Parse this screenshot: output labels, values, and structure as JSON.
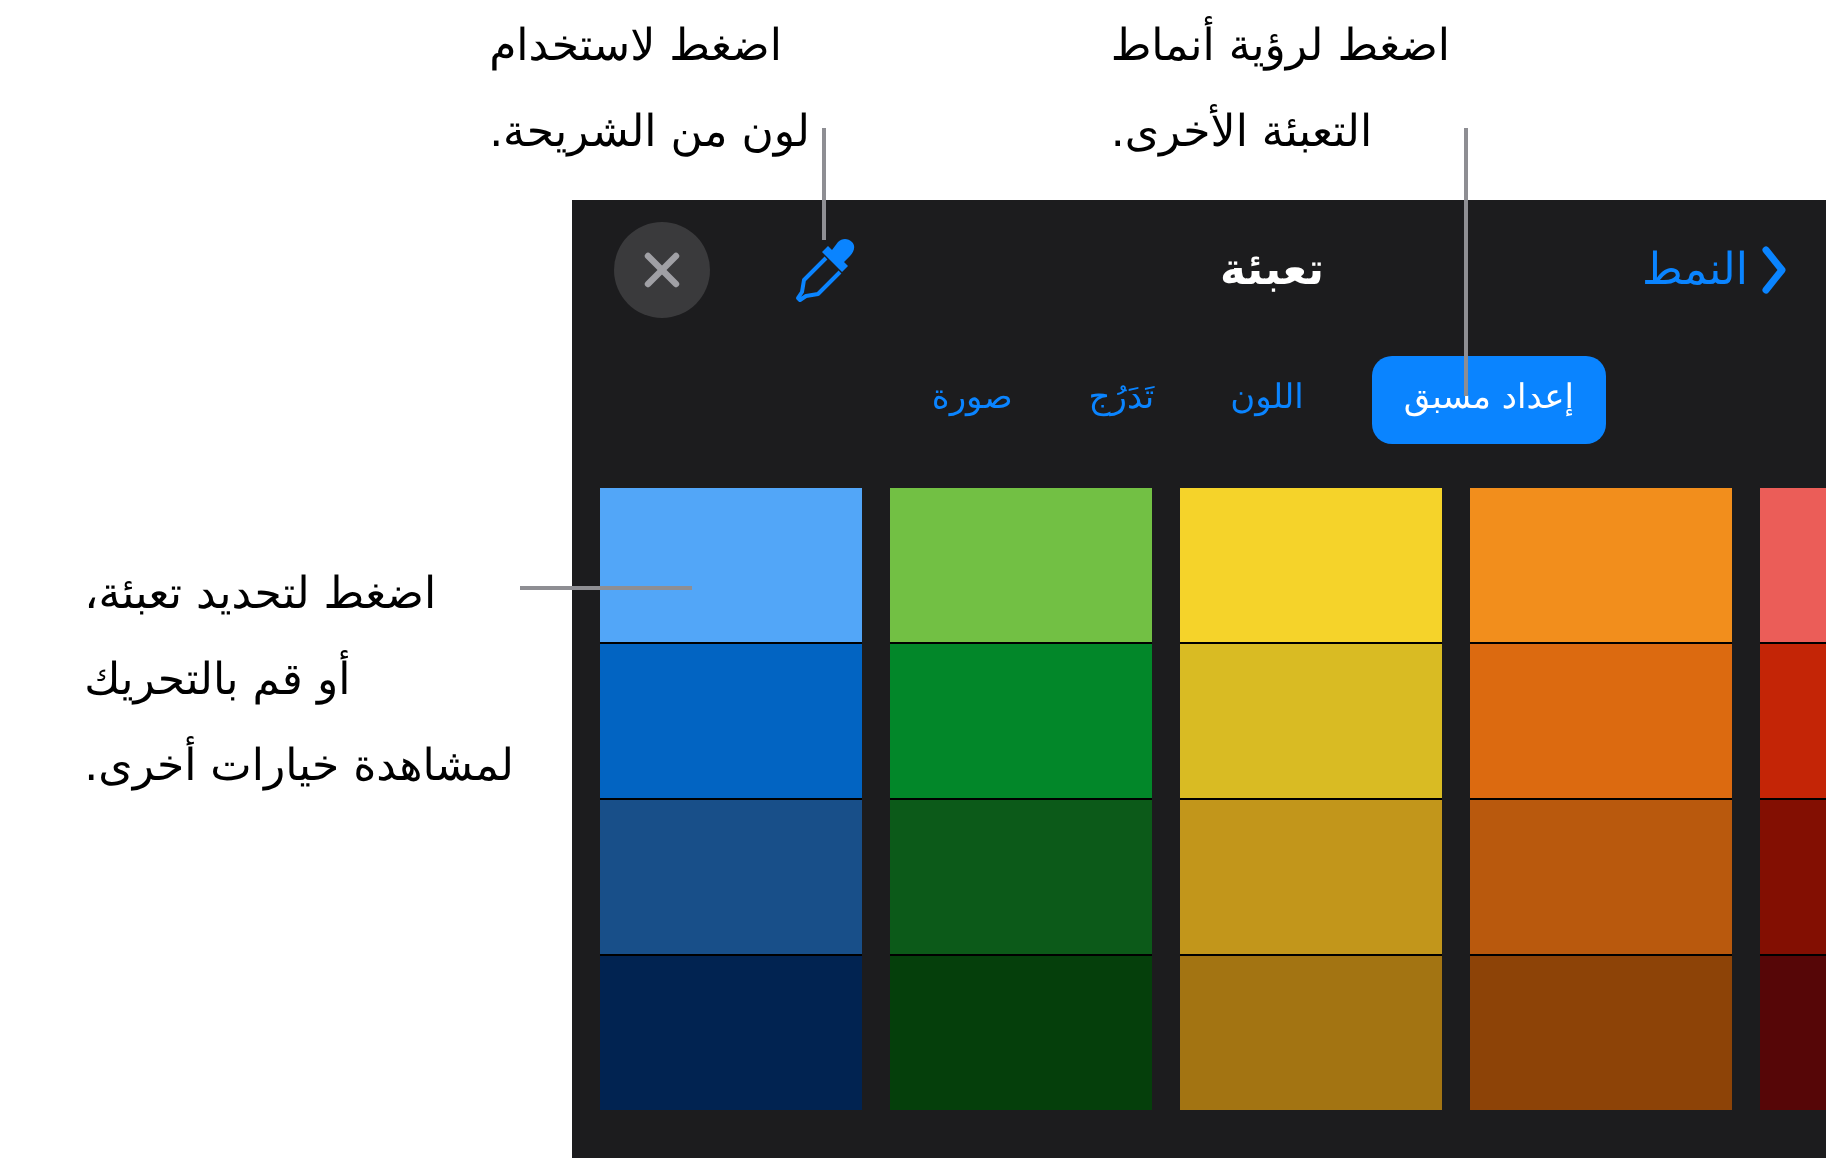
{
  "callouts": [
    {
      "kind": "tabs",
      "lines": [
        "اضغط لرؤية أنماط",
        "التعبئة الأخرى."
      ]
    },
    {
      "kind": "eyedropper",
      "lines": [
        "اضغط لاستخدام",
        "لون من الشريحة."
      ]
    },
    {
      "kind": "swatch",
      "lines": [
        "اضغط لتحديد تعبئة،",
        "أو قم بالتحريك",
        "لمشاهدة خيارات أخرى."
      ]
    }
  ],
  "header": {
    "back": "النمط",
    "title": "تعبئة"
  },
  "tabs": [
    {
      "label": "إعداد مسبق",
      "selected": true
    },
    {
      "label": "اللون",
      "selected": false
    },
    {
      "label": "تَدَرُج",
      "selected": false
    },
    {
      "label": "صورة",
      "selected": false
    }
  ],
  "palette": [
    {
      "swatches": [
        {
          "color": "#52a6f8"
        },
        {
          "color": "#0264c2"
        },
        {
          "color": "#184f89"
        },
        {
          "color": "#012351"
        }
      ]
    },
    {
      "swatches": [
        {
          "color": "#72c044"
        },
        {
          "color": "#028729"
        },
        {
          "color": "#0c5a19"
        },
        {
          "color": "#053f0b"
        }
      ]
    },
    {
      "swatches": [
        {
          "color": "#f5d32a"
        },
        {
          "color": "#d9bb23"
        },
        {
          "color": "#c2961b"
        },
        {
          "color": "#a37412"
        }
      ]
    },
    {
      "swatches": [
        {
          "color": "#f28e1c"
        },
        {
          "color": "#dc6a10"
        },
        {
          "color": "#b9590d"
        },
        {
          "color": "#8d4307"
        }
      ]
    },
    {
      "swatches": [
        {
          "color": "#eb5d58"
        },
        {
          "color": "#c42506"
        },
        {
          "color": "#830f02"
        },
        {
          "color": "#560607"
        }
      ]
    }
  ]
}
